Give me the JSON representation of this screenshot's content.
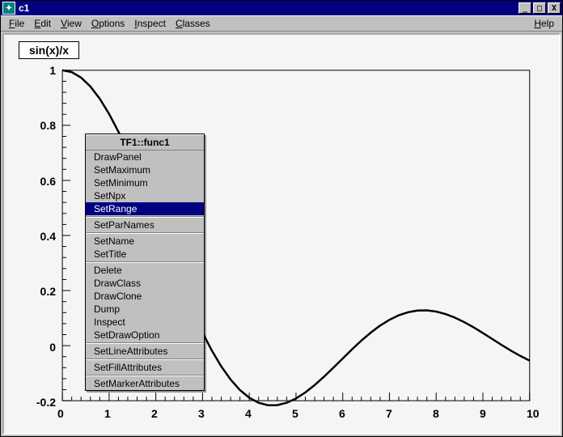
{
  "window": {
    "title": "c1"
  },
  "menubar": {
    "file": "File",
    "edit": "Edit",
    "view": "View",
    "options": "Options",
    "inspect": "Inspect",
    "classes": "Classes",
    "help": "Help"
  },
  "formula": "sin(x)/x",
  "context_menu": {
    "title": "TF1::func1",
    "items": {
      "drawpanel": "DrawPanel",
      "setmaximum": "SetMaximum",
      "setminimum": "SetMinimum",
      "setnpx": "SetNpx",
      "setrange": "SetRange",
      "setparnames": "SetParNames",
      "setname": "SetName",
      "settitle": "SetTitle",
      "delete": "Delete",
      "drawclass": "DrawClass",
      "drawclone": "DrawClone",
      "dump": "Dump",
      "inspect": "Inspect",
      "setdrawoption": "SetDrawOption",
      "setlineattributes": "SetLineAttributes",
      "setfillattributes": "SetFillAttributes",
      "setmarkerattributes": "SetMarkerAttributes"
    },
    "selected": "setrange"
  },
  "chart_data": {
    "type": "line",
    "title": "sin(x)/x",
    "xlabel": "",
    "ylabel": "",
    "xlim": [
      0,
      10
    ],
    "ylim": [
      -0.2,
      1.0
    ],
    "xticks": [
      0,
      1,
      2,
      3,
      4,
      5,
      6,
      7,
      8,
      9,
      10
    ],
    "yticks": [
      -0.2,
      0,
      0.2,
      0.4,
      0.6,
      0.8,
      1.0
    ],
    "series": [
      {
        "name": "func1",
        "x": [
          0.0,
          0.2,
          0.4,
          0.6,
          0.8,
          1.0,
          1.2,
          1.4,
          1.6,
          1.8,
          2.0,
          2.2,
          2.4,
          2.6,
          2.8,
          3.0,
          3.2,
          3.4,
          3.6,
          3.8,
          4.0,
          4.2,
          4.4,
          4.6,
          4.8,
          5.0,
          5.2,
          5.4,
          5.6,
          5.8,
          6.0,
          6.2,
          6.4,
          6.6,
          6.8,
          7.0,
          7.2,
          7.4,
          7.6,
          7.8,
          8.0,
          8.2,
          8.4,
          8.6,
          8.8,
          9.0,
          9.2,
          9.4,
          9.6,
          9.8,
          10.0
        ],
        "y": [
          1.0,
          0.9933,
          0.9735,
          0.9411,
          0.8967,
          0.8415,
          0.7767,
          0.7039,
          0.6247,
          0.541,
          0.4546,
          0.3675,
          0.2814,
          0.1983,
          0.1196,
          0.047,
          -0.0182,
          -0.0752,
          -0.1229,
          -0.161,
          -0.1892,
          -0.2075,
          -0.2163,
          -0.216,
          -0.2075,
          -0.1918,
          -0.1699,
          -0.1431,
          -0.1127,
          -0.0801,
          -0.0466,
          -0.0134,
          0.0182,
          0.0472,
          0.0727,
          0.0939,
          0.1102,
          0.1214,
          0.1274,
          0.128,
          0.1237,
          0.1147,
          0.1017,
          0.0854,
          0.0665,
          0.0458,
          0.0242,
          0.0026,
          -0.0182,
          -0.0374,
          -0.0544
        ]
      }
    ]
  },
  "xtick_labels": {
    "0": "0",
    "1": "1",
    "2": "2",
    "3": "3",
    "4": "4",
    "5": "5",
    "6": "6",
    "7": "7",
    "8": "8",
    "9": "9",
    "10": "10"
  },
  "ytick_labels": {
    "m02": "-0.2",
    "0": "0",
    "02": "0.2",
    "04": "0.4",
    "06": "0.6",
    "08": "0.8",
    "1": "1"
  }
}
